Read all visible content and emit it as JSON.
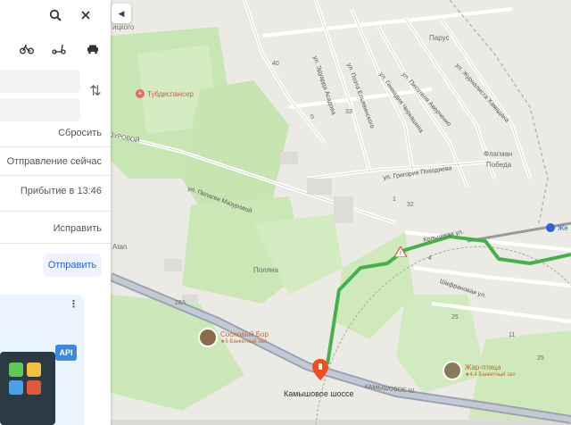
{
  "panel": {
    "icons": {
      "search": "search-icon",
      "close": "close-icon",
      "bike": "bicycle-icon",
      "scooter": "scooter-icon",
      "taxi": "taxi-icon",
      "swap": "swap-icon"
    },
    "reset_label": "Сбросить",
    "departure_label": "Отправление сейчас",
    "arrival_label": "Прибытие в 13:46",
    "fix_label": "Исправить",
    "send_label": "Отправить",
    "ad_badge": "API"
  },
  "map": {
    "top_label": "ицкого",
    "tubdispanser": "Тубдиспансер",
    "parus": "Парус",
    "flagman": "Флагман",
    "pobeda": "Победа",
    "atan": "Atan",
    "polyana": "Поляна",
    "numbers": {
      "n40": "40",
      "n5": "5",
      "n33": "33",
      "n28a": "28А",
      "n25": "25",
      "n11": "11",
      "n25b": "25",
      "n32": "32",
      "n1": "1",
      "n4": "4"
    },
    "streets": {
      "mazurova_top": "ул. Пелагеи Мазуровой",
      "mazurovoy": "ул. Пелагеи Мазуровой",
      "asadova": "ул. Эдуарда Асадова",
      "yelyavinskogo": "ул. Поэта Ельявинского",
      "cherkashina": "ул. Геннадия Черкашина",
      "averchenko": "ул. Писателя Аверченко",
      "khamadana": "ул. Журналиста Хамадана",
      "pokhodyayeva": "ул. Григория Походяева",
      "koltsevaya": "Кольцевая ул.",
      "shafranovaya": "Шафрановая ул.",
      "kamyshovoe_road": "КАМЫШОВОЕ Ш.",
      "mazurovoy_side": "ЗУРОВОЙ"
    },
    "poi_sosnovy": {
      "name": "Сосновый Бор",
      "sub": "★5 Банкетный зал"
    },
    "poi_zhar": {
      "name": "Жар-птица",
      "sub": "★4.4 Банкетный зал"
    },
    "destination": "Камышовое шоссе",
    "metro": "Же",
    "route_color": "#44b24a",
    "pin_color": "#f04e1e"
  }
}
